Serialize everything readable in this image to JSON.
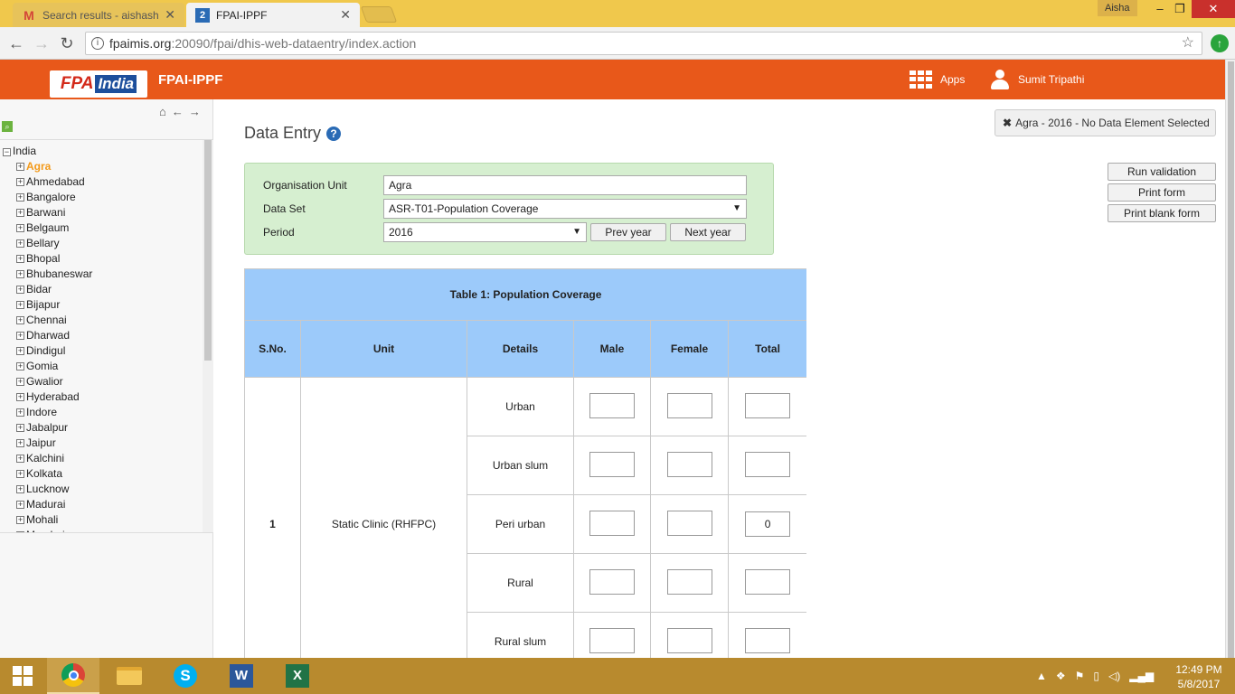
{
  "browser": {
    "tabs": [
      {
        "title": "Search results - aishasha",
        "icon": "gmail-icon"
      },
      {
        "title": "FPAI-IPPF",
        "icon": "dhis-icon"
      }
    ],
    "profile": "Aisha",
    "url_host": "fpaimis.org",
    "url_path": ":20090/fpai/dhis-web-dataentry/index.action"
  },
  "header": {
    "logo_part1": "FPA",
    "logo_part2": "India",
    "title": "FPAI-IPPF",
    "apps_label": "Apps",
    "user_name": "Sumit Tripathi",
    "accent": "#e8581a"
  },
  "tree": {
    "root": "India",
    "selected": "Agra",
    "nodes": [
      "Agra",
      "Ahmedabad",
      "Bangalore",
      "Barwani",
      "Belgaum",
      "Bellary",
      "Bhopal",
      "Bhubaneswar",
      "Bidar",
      "Bijapur",
      "Chennai",
      "Dharwad",
      "Dindigul",
      "Gomia",
      "Gwalior",
      "Hyderabad",
      "Indore",
      "Jabalpur",
      "Jaipur",
      "Kalchini",
      "Kolkata",
      "Lucknow",
      "Madurai",
      "Mohali",
      "Mumbai"
    ]
  },
  "main": {
    "title": "Data Entry",
    "context_message": "Agra - 2016 - No Data Element Selected",
    "side_buttons": [
      "Run validation",
      "Print form",
      "Print blank form"
    ],
    "form": {
      "org_label": "Organisation Unit",
      "org_value": "Agra",
      "dataset_label": "Data Set",
      "dataset_value": "ASR-T01-Population Coverage",
      "period_label": "Period",
      "period_value": "2016",
      "prev_year": "Prev year",
      "next_year": "Next year"
    },
    "table": {
      "caption": "Table 1: Population Coverage",
      "headers": [
        "S.No.",
        "Unit",
        "Details",
        "Male",
        "Female",
        "Total"
      ],
      "sno": "1",
      "unit": "Static Clinic (RHFPC)",
      "rows": [
        {
          "detail": "Urban",
          "male": "",
          "female": "",
          "total": ""
        },
        {
          "detail": "Urban slum",
          "male": "",
          "female": "",
          "total": ""
        },
        {
          "detail": "Peri urban",
          "male": "",
          "female": "",
          "total": "0"
        },
        {
          "detail": "Rural",
          "male": "",
          "female": "",
          "total": ""
        },
        {
          "detail": "Rural slum",
          "male": "",
          "female": "",
          "total": ""
        }
      ]
    }
  },
  "taskbar": {
    "time": "12:49 PM",
    "date": "5/8/2017"
  }
}
